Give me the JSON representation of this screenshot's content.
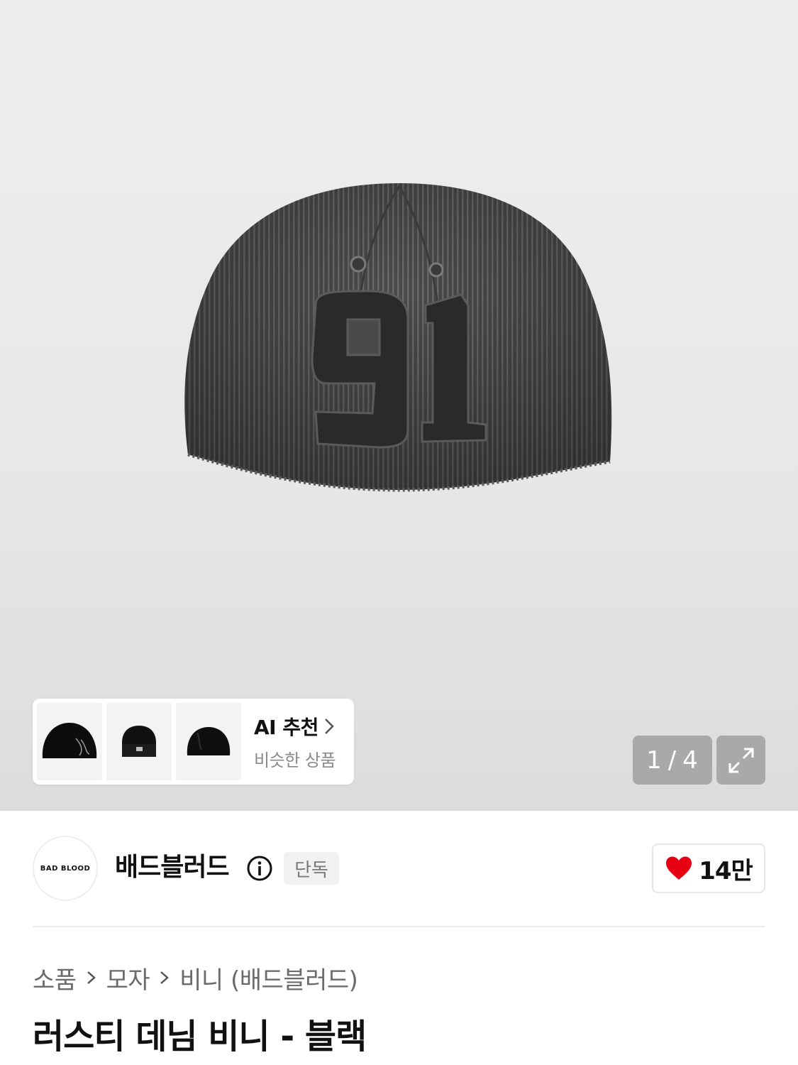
{
  "gallery": {
    "hero_alt": "black washed rib beanie with 91 patch",
    "counter": {
      "current": "1",
      "separator": "/",
      "total": "4"
    },
    "expand_icon": "expand-icon",
    "thumbnails": [
      {
        "icon": "beanie-thumbnail-1"
      },
      {
        "icon": "beanie-thumbnail-2"
      },
      {
        "icon": "beanie-thumbnail-3"
      }
    ],
    "ai": {
      "title": "AI 추천",
      "subtitle": "비슷한 상품",
      "icon": "chevron-right-icon"
    }
  },
  "brand": {
    "logo_text": "BAD BLOOD",
    "name": "배드블러드",
    "info_icon": "info-icon",
    "badge": "단독"
  },
  "like": {
    "icon": "heart-icon",
    "count": "14만",
    "color": "#e60012"
  },
  "breadcrumb": {
    "items": [
      "소품",
      "모자",
      "비니 (배드블러드)"
    ],
    "separator_icon": "chevron-right-icon"
  },
  "product": {
    "title": "러스티 데님 비니 - 블랙"
  }
}
